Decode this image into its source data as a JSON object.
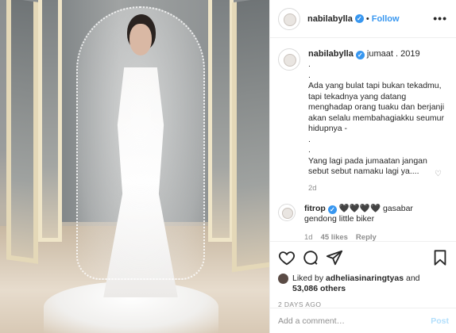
{
  "header": {
    "username": "nabilabylla",
    "separator": "•",
    "follow_label": "Follow",
    "more_label": "•••"
  },
  "caption": {
    "username": "nabilabylla",
    "tag": "jumaat . 2019",
    "text": ".\n.\nAda yang bulat tapi bukan tekadmu,\ntapi tekadnya yang datang menghadap orang tuaku dan berjanji akan selalu membahagiakku seumur hidupnya -\n.\n.\nYang lagi pada jumaatan jangan sebut sebut namaku lagi ya....",
    "time": "2d"
  },
  "comment": {
    "username": "fitrop",
    "text": "🖤🖤🖤🖤 gasabar gendong little biker",
    "time": "1d",
    "likes": "45 likes",
    "reply": "Reply"
  },
  "actions": {
    "liked_prefix": "Liked by ",
    "liked_user": "adheliasinaringtyas",
    "liked_mid": " and",
    "liked_count": "53,086 others",
    "posted": "2 DAYS AGO"
  },
  "add_comment": {
    "placeholder": "Add a comment…",
    "post_label": "Post"
  },
  "colors": {
    "accent": "#3897f0",
    "muted": "#8e8e8e",
    "post_disabled": "#b2dffc"
  },
  "icons": [
    "heart-icon",
    "comment-icon",
    "share-icon",
    "bookmark-icon",
    "verified-badge-icon",
    "more-icon"
  ]
}
